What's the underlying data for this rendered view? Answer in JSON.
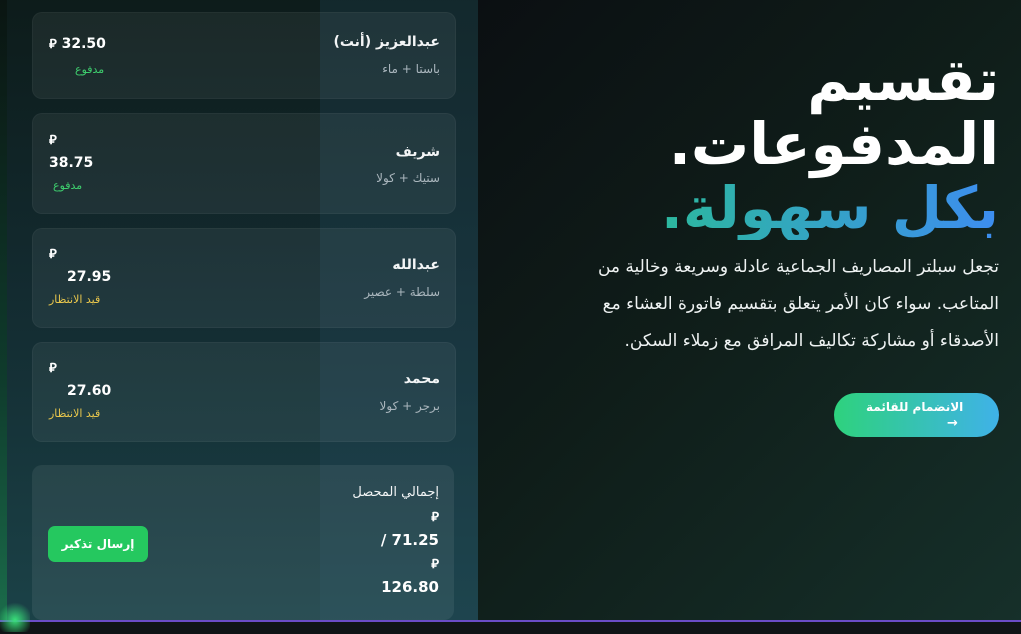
{
  "currency_symbol": "⃁",
  "members": [
    {
      "name": "عبدالعزيز (أنت)",
      "items": "باستا + ماء",
      "amount": "32.50",
      "status": "مدفوع",
      "status_type": "paid"
    },
    {
      "name": "شريف",
      "items": "ستيك + كولا",
      "amount": "38.75",
      "status": "مدفوع",
      "status_type": "paid"
    },
    {
      "name": "عبدالله",
      "items": "سلطة + عصير",
      "amount": "27.95",
      "status": "قيد الانتظار",
      "status_type": "pending"
    },
    {
      "name": "محمد",
      "items": "برجر + كولا",
      "amount": "27.60",
      "status": "قيد الانتظار",
      "status_type": "pending"
    }
  ],
  "total": {
    "label": "إجمالي المحصل",
    "collected": "71.25",
    "separator": "/",
    "total": "126.80",
    "reminder_button": "إرسال تذكير"
  },
  "hero": {
    "title_line1": "تقسيم",
    "title_line2": "المدفوعات.",
    "title_line3": "بكل سهولة.",
    "description": "تجعل سبلتر المصاريف الجماعية عادلة وسريعة وخالية من المتاعب. سواء كان الأمر يتعلق بتقسيم فاتورة العشاء مع الأصدقاء أو مشاركة تكاليف المرافق مع زملاء السكن.",
    "cta_label": "الانضمام للقائمة",
    "cta_icon": "arrow-right-icon"
  },
  "colors": {
    "paid": "#3ecf6e",
    "pending": "#e8c64c",
    "accent_green": "#25c85f",
    "accent_blue": "#3d8df0"
  }
}
